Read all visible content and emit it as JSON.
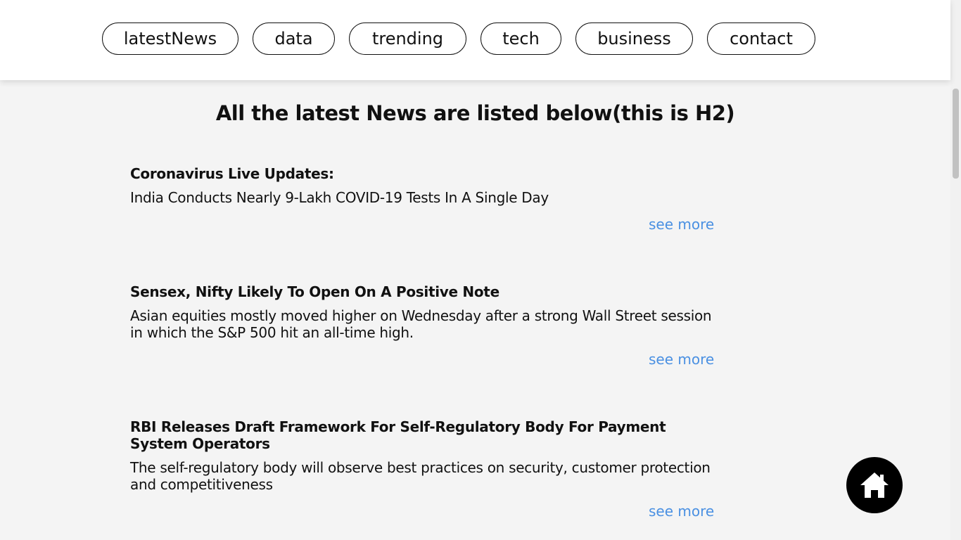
{
  "nav": {
    "items": [
      {
        "label": "latestNews"
      },
      {
        "label": "data"
      },
      {
        "label": "trending"
      },
      {
        "label": "tech"
      },
      {
        "label": "business"
      },
      {
        "label": "contact"
      }
    ]
  },
  "main": {
    "heading": "All the latest News are listed below(this is H2)",
    "articles": [
      {
        "title": "Coronavirus Live Updates:",
        "summary": "India Conducts Nearly 9-Lakh COVID-19 Tests In A Single Day",
        "link": "see more"
      },
      {
        "title": "Sensex, Nifty Likely To Open On A Positive Note",
        "summary": "Asian equities mostly moved higher on Wednesday after a strong Wall Street session in which the S&P 500 hit an all-time high.",
        "link": "see more"
      },
      {
        "title": "RBI Releases Draft Framework For Self-Regulatory Body For Payment System Operators",
        "summary": "The self-regulatory body will observe best practices on security, customer protection and competitiveness",
        "link": "see more"
      }
    ]
  },
  "floating": {
    "home_icon": "home-icon"
  },
  "colors": {
    "link": "#4a90e2",
    "page_bg": "#f4f4f4",
    "home_button_bg": "#000000"
  }
}
